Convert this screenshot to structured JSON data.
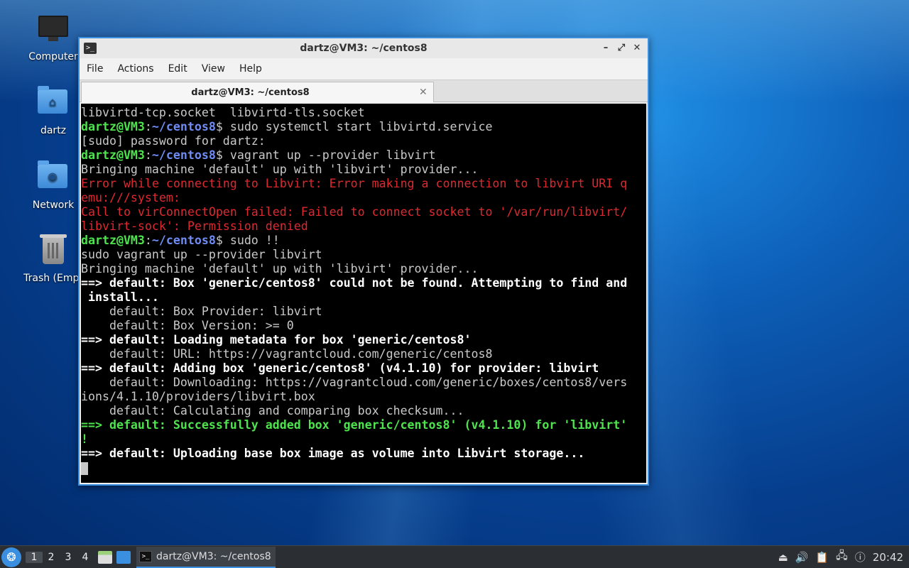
{
  "desktop": {
    "icons": [
      {
        "label": "Computer",
        "icon": "computer-icon"
      },
      {
        "label": "dartz",
        "icon": "home-folder-icon"
      },
      {
        "label": "Network",
        "icon": "network-folder-icon"
      },
      {
        "label": "Trash (Empt",
        "icon": "trash-icon"
      }
    ]
  },
  "window": {
    "title": "dartz@VM3: ~/centos8",
    "menu": [
      "File",
      "Actions",
      "Edit",
      "View",
      "Help"
    ],
    "tab_title": "dartz@VM3: ~/centos8",
    "controls": {
      "minimize": "–",
      "maximize": "⤢",
      "close": "✕"
    }
  },
  "terminal": {
    "prompt_user": "dartz@VM3",
    "prompt_sep": ":",
    "prompt_path": "~/centos8",
    "prompt_end": "$",
    "lines": [
      {
        "type": "plain",
        "text": "libvirtd-tcp.socket  libvirtd-tls.socket"
      },
      {
        "type": "prompt",
        "cmd": " sudo systemctl start libvirtd.service"
      },
      {
        "type": "plain",
        "text": "[sudo] password for dartz:"
      },
      {
        "type": "prompt",
        "cmd": " vagrant up --provider libvirt"
      },
      {
        "type": "plain",
        "text": "Bringing machine 'default' up with 'libvirt' provider..."
      },
      {
        "type": "error",
        "text": "Error while connecting to Libvirt: Error making a connection to libvirt URI q"
      },
      {
        "type": "error",
        "text": "emu:///system:"
      },
      {
        "type": "error",
        "text": "Call to virConnectOpen failed: Failed to connect socket to '/var/run/libvirt/"
      },
      {
        "type": "error",
        "text": "libvirt-sock': Permission denied"
      },
      {
        "type": "prompt",
        "cmd": " sudo !!"
      },
      {
        "type": "plain",
        "text": "sudo vagrant up --provider libvirt"
      },
      {
        "type": "plain",
        "text": "Bringing machine 'default' up with 'libvirt' provider..."
      },
      {
        "type": "bold",
        "text": "==> default: Box 'generic/centos8' could not be found. Attempting to find and"
      },
      {
        "type": "bold",
        "text": " install..."
      },
      {
        "type": "plain",
        "text": "    default: Box Provider: libvirt"
      },
      {
        "type": "plain",
        "text": "    default: Box Version: >= 0"
      },
      {
        "type": "bold",
        "text": "==> default: Loading metadata for box 'generic/centos8'"
      },
      {
        "type": "plain",
        "text": "    default: URL: https://vagrantcloud.com/generic/centos8"
      },
      {
        "type": "bold",
        "text": "==> default: Adding box 'generic/centos8' (v4.1.10) for provider: libvirt"
      },
      {
        "type": "plain",
        "text": "    default: Downloading: https://vagrantcloud.com/generic/boxes/centos8/vers"
      },
      {
        "type": "plain",
        "text": "ions/4.1.10/providers/libvirt.box"
      },
      {
        "type": "plain",
        "text": "    default: Calculating and comparing box checksum..."
      },
      {
        "type": "success",
        "text": "==> default: Successfully added box 'generic/centos8' (v4.1.10) for 'libvirt'"
      },
      {
        "type": "success",
        "text": "!"
      },
      {
        "type": "bold",
        "text": "==> default: Uploading base box image as volume into Libvirt storage..."
      },
      {
        "type": "cursor",
        "text": ""
      }
    ]
  },
  "taskbar": {
    "desktops": [
      "1",
      "2",
      "3",
      "4"
    ],
    "active_desktop": "1",
    "task_label": "dartz@VM3: ~/centos8",
    "clock": "20:42"
  },
  "colors": {
    "accent": "#3b8fe0",
    "prompt_user": "#4ee44e",
    "prompt_path": "#6f8cf5",
    "error": "#e0282f",
    "success": "#4ee44e"
  }
}
